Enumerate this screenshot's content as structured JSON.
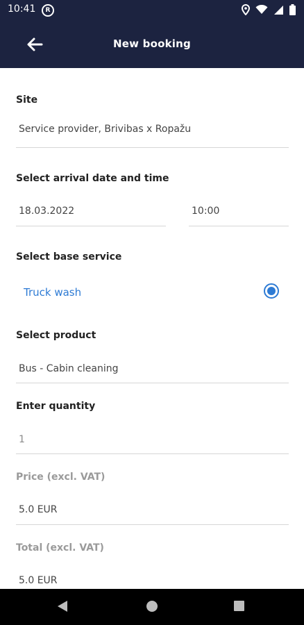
{
  "status_bar": {
    "time": "10:41",
    "notification_icon": "registered-icon",
    "icons": [
      "location-icon",
      "wifi-icon",
      "signal-icon",
      "battery-icon"
    ]
  },
  "app_bar": {
    "title": "New booking",
    "back_icon": "arrow-left-icon"
  },
  "form": {
    "site": {
      "label": "Site",
      "value": "Service provider, Brivibas x Ropažu"
    },
    "arrival": {
      "label": "Select arrival date and time",
      "date": "18.03.2022",
      "time": "10:00"
    },
    "base_service": {
      "label": "Select base service",
      "option": "Truck wash",
      "selected": true
    },
    "product": {
      "label": "Select product",
      "value": "Bus - Cabin cleaning"
    },
    "quantity": {
      "label": "Enter quantity",
      "value": "1"
    },
    "price": {
      "label": "Price (excl. VAT)",
      "value": "5.0 EUR"
    },
    "total": {
      "label": "Total (excl. VAT)",
      "value": "5.0 EUR"
    }
  },
  "colors": {
    "header_bg": "#1c2340",
    "accent": "#2e7bd4",
    "nav_bg": "#000000"
  },
  "nav_bar": {
    "icons": [
      "back-triangle-icon",
      "home-circle-icon",
      "recents-square-icon"
    ]
  }
}
